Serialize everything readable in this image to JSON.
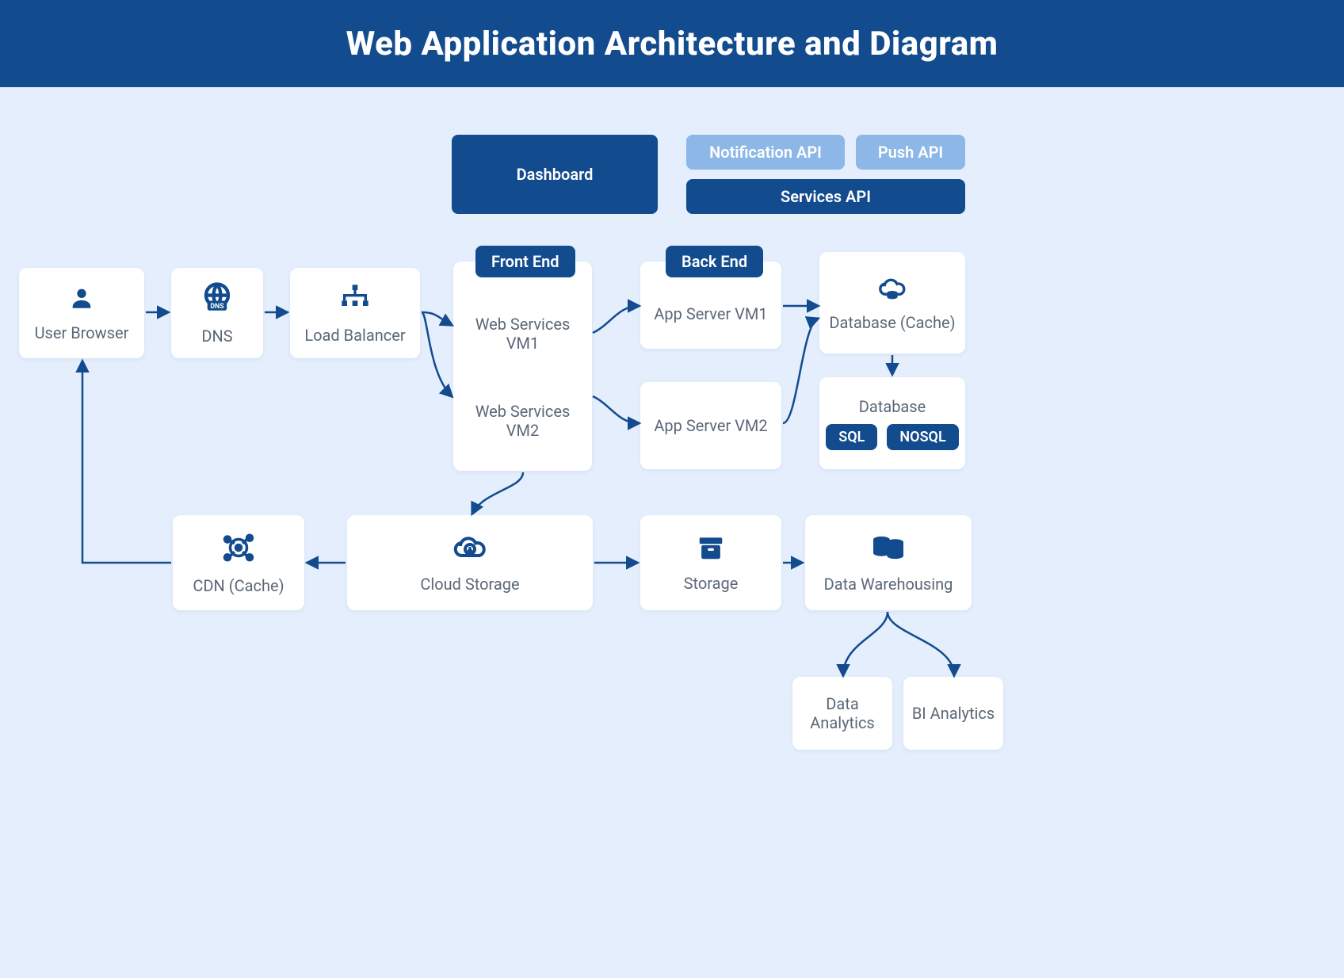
{
  "title": "Web Application Architecture and Diagram",
  "top": {
    "dashboard": "Dashboard",
    "notification_api": "Notification API",
    "push_api": "Push API",
    "services_api": "Services API"
  },
  "nodes": {
    "user_browser": "User Browser",
    "dns": "DNS",
    "load_balancer": "Load Balancer",
    "web_services_vm1": "Web Services VM1",
    "web_services_vm2": "Web Services VM2",
    "app_server_vm1": "App Server VM1",
    "app_server_vm2": "App Server VM2",
    "db_cache": "Database (Cache)",
    "db": "Database",
    "sql": "SQL",
    "nosql": "NOSQL",
    "cdn": "CDN (Cache)",
    "cloud_storage": "Cloud Storage",
    "storage": "Storage",
    "data_warehousing": "Data Warehousing",
    "data_analytics": "Data Analytics",
    "bi_analytics": "BI Analytics"
  },
  "labels": {
    "front_end": "Front End",
    "back_end": "Back End"
  },
  "colors": {
    "primary": "#124b8e",
    "light": "#8db7e6",
    "bg": "#e4eefc",
    "text": "#5b6877"
  }
}
